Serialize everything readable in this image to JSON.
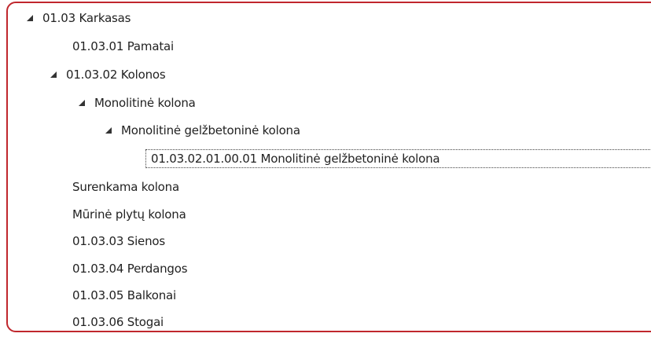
{
  "tree": {
    "colors": {
      "border": "#c0272d",
      "text": "#222222",
      "toggle": "#333333"
    },
    "nodes": [
      {
        "label": "01.03 Karkasas",
        "level": 0,
        "expanded": true,
        "icon": "expanded-triangle-icon"
      },
      {
        "label": "01.03.01 Pamatai",
        "level": 1,
        "expanded": false
      },
      {
        "label": "01.03.02 Kolonos",
        "level": 1,
        "expanded": true,
        "icon": "expanded-triangle-icon"
      },
      {
        "label": "Monolitinė kolona",
        "level": 2,
        "expanded": true,
        "icon": "expanded-triangle-icon"
      },
      {
        "label": "Monolitinė gelžbetoninė kolona",
        "level": 3,
        "expanded": true,
        "icon": "expanded-triangle-icon"
      },
      {
        "label": "01.03.02.01.00.01 Monolitinė gelžbetoninė kolona",
        "level": 4,
        "selected": true
      },
      {
        "label": "Surenkama kolona",
        "level": 2,
        "expanded": false
      },
      {
        "label": "Mūrinė plytų kolona",
        "level": 2,
        "expanded": false
      },
      {
        "label": "01.03.03 Sienos",
        "level": 1,
        "expanded": false
      },
      {
        "label": "01.03.04 Perdangos",
        "level": 1,
        "expanded": false
      },
      {
        "label": "01.03.05 Balkonai",
        "level": 1,
        "expanded": false
      },
      {
        "label": "01.03.06 Stogai",
        "level": 1,
        "expanded": false
      }
    ]
  }
}
